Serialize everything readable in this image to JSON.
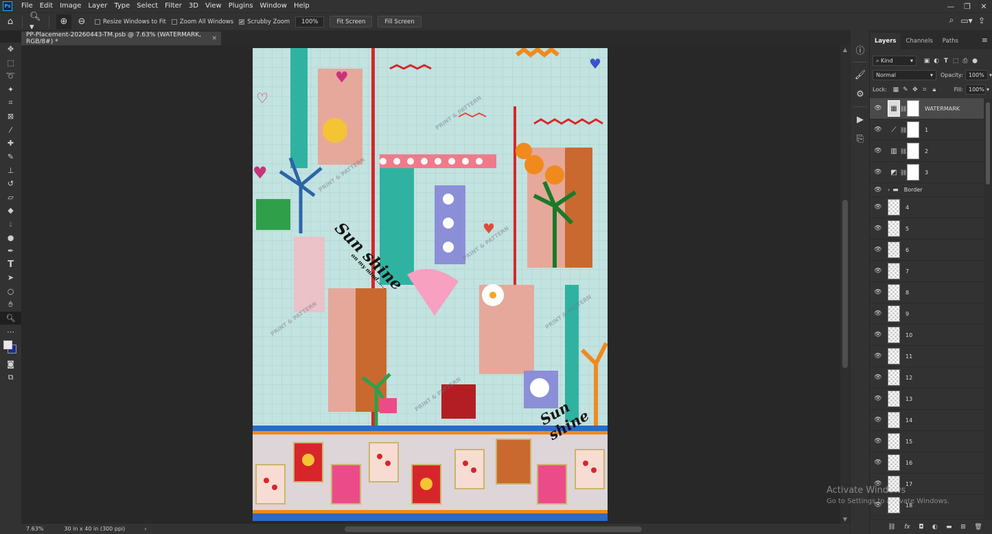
{
  "app": {
    "logo": "Ps",
    "menu": [
      "File",
      "Edit",
      "Image",
      "Layer",
      "Type",
      "Select",
      "Filter",
      "3D",
      "View",
      "Plugins",
      "Window",
      "Help"
    ]
  },
  "window_controls": {
    "minimize": "—",
    "restore": "❐",
    "close": "✕"
  },
  "options_bar": {
    "tool_icon": "zoom-icon",
    "resize_windows": {
      "label": "Resize Windows to Fit",
      "checked": false
    },
    "zoom_all": {
      "label": "Zoom All Windows",
      "checked": false
    },
    "scrubby_zoom": {
      "label": "Scrubby Zoom",
      "checked": true
    },
    "zoom_value": "100%",
    "fit_screen": "Fit Screen",
    "fill_screen": "Fill Screen"
  },
  "document": {
    "tab_title": "PP-Placement-20260443-TM.psb @ 7.63% (WATERMARK, RGB/8#) *",
    "close": "×",
    "zoom": "7.63%",
    "doc_info": "30 in x 40 in (300 ppi)"
  },
  "artwork": {
    "watermark_text": "PRINT & PATTERN",
    "sunshine_text_1": "Sun shine",
    "sunshine_sub": "on my mind......",
    "sunshine_text_2": "Sun shine",
    "colors": {
      "bg": "#c2e3e0",
      "teal": "#2fb3a0",
      "terracotta": "#c9692f",
      "blush": "#e6a89a",
      "red": "#d7262a",
      "lavender": "#8b8fd8",
      "pink": "#ec4b8a",
      "orange": "#f08a1c",
      "yellow": "#f5c434",
      "green": "#2f9f4a"
    }
  },
  "layers_panel": {
    "tabs": [
      "Layers",
      "Channels",
      "Paths"
    ],
    "filter_kind": "Kind",
    "blend_mode": "Normal",
    "opacity_label": "Opacity:",
    "opacity_value": "100%",
    "lock_label": "Lock:",
    "fill_label": "Fill:",
    "fill_value": "100%",
    "layers": [
      {
        "name": "WATERMARK",
        "type": "adjustment",
        "selected": true
      },
      {
        "name": "1",
        "type": "adjustment"
      },
      {
        "name": "2",
        "type": "adjustment"
      },
      {
        "name": "3",
        "type": "adjustment"
      },
      {
        "name": "Border",
        "type": "group"
      },
      {
        "name": "4",
        "type": "pixel"
      },
      {
        "name": "5",
        "type": "pixel"
      },
      {
        "name": "6",
        "type": "pixel"
      },
      {
        "name": "7",
        "type": "pixel"
      },
      {
        "name": "8",
        "type": "pixel"
      },
      {
        "name": "9",
        "type": "pixel"
      },
      {
        "name": "10",
        "type": "pixel"
      },
      {
        "name": "11",
        "type": "pixel"
      },
      {
        "name": "12",
        "type": "pixel"
      },
      {
        "name": "13",
        "type": "pixel"
      },
      {
        "name": "14",
        "type": "pixel"
      },
      {
        "name": "15",
        "type": "pixel"
      },
      {
        "name": "16",
        "type": "pixel"
      },
      {
        "name": "17",
        "type": "pixel"
      },
      {
        "name": "18",
        "type": "pixel"
      }
    ],
    "footer_icons": [
      "link-icon",
      "fx-icon",
      "mask-icon",
      "adjustment-icon",
      "folder-icon",
      "new-layer-icon",
      "trash-icon"
    ]
  },
  "activate_windows": {
    "title": "Activate Windows",
    "subtitle": "Go to Settings to activate Windows."
  }
}
